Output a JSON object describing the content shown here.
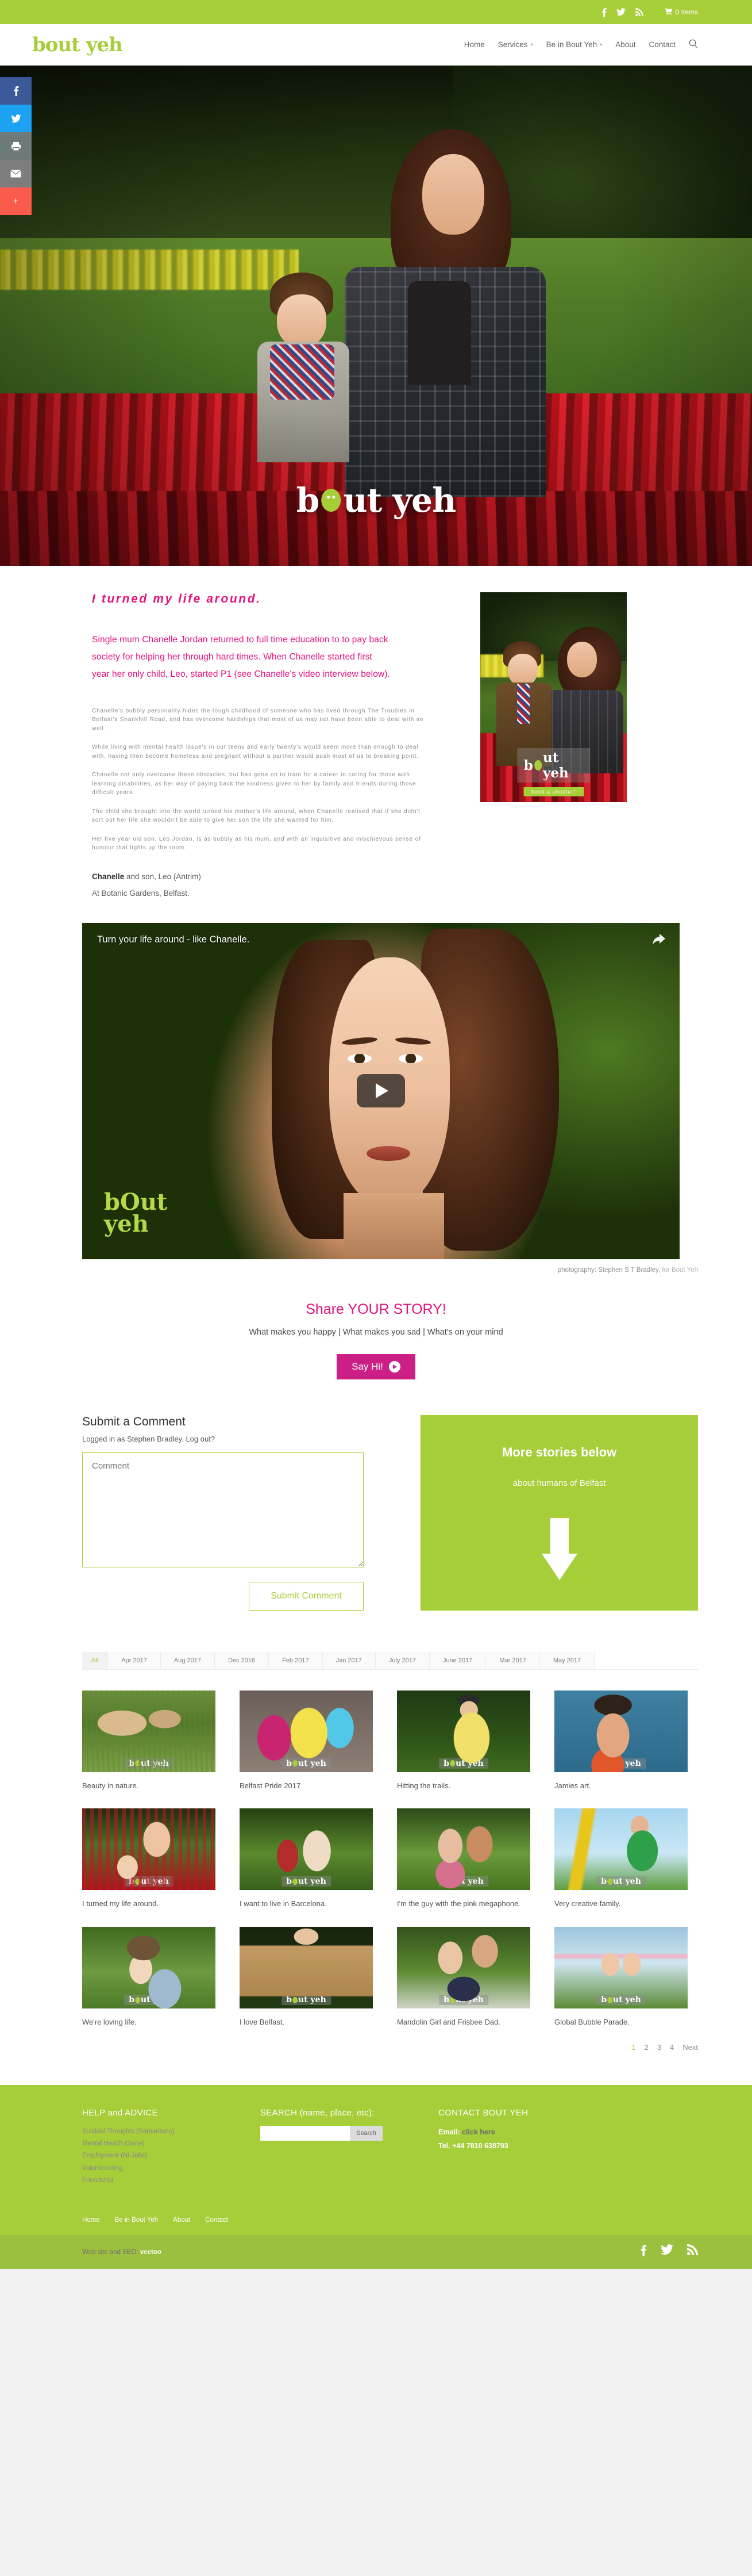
{
  "topbar": {
    "social": [
      {
        "name": "facebook-icon",
        "glyph": "f"
      },
      {
        "name": "twitter-icon",
        "glyph": "🐦"
      },
      {
        "name": "rss-icon",
        "glyph": "≋"
      }
    ],
    "cart_label": "0 Items",
    "cart_icon": "cart-icon"
  },
  "header": {
    "logo": "bout yeh",
    "nav": [
      {
        "label": "Home",
        "has_caret": false
      },
      {
        "label": "Services",
        "has_caret": true
      },
      {
        "label": "Be in Bout Yeh",
        "has_caret": true
      },
      {
        "label": "About",
        "has_caret": false
      },
      {
        "label": "Contact",
        "has_caret": false
      }
    ],
    "search_icon": "search-icon"
  },
  "share_rail": [
    {
      "name": "share-facebook",
      "glyph": "f"
    },
    {
      "name": "share-twitter",
      "glyph": "🐦"
    },
    {
      "name": "share-print",
      "glyph": "⎙"
    },
    {
      "name": "share-email",
      "glyph": "✉"
    },
    {
      "name": "share-more",
      "glyph": "+"
    }
  ],
  "hero": {
    "logo_text_1": "b",
    "logo_text_2": "ut yeh"
  },
  "article": {
    "headline": "I turned my life around.",
    "lead": "Single mum Chanelle Jordan returned to full time education to to pay back society for helping her through hard times. When Chanelle started first year her only child, Leo, started P1 (see Chanelle's video interview below).",
    "paragraphs": [
      "Chanelle's bubbly personality hides the tough childhood of someone who has lived through The Troubles in Belfast's Shankhill Road, and has overcome hardships that most of us may not have been able to deal with so well.",
      "While living with mental health issue's in our teens and early twenty's would seem more than enough to deal with, having then become homeless and pregnant without a partner would push most of us to breaking point.",
      "Chanelle not only overcame these obstacles, but has gone on to train for a career in caring for those with learning disabilities, as her way of paying back the kindness given to her by family and friends during those difficult years.",
      "The child she brought into the world turned his mother's life around, when Chanelle realised that if she didn't sort out her life she wouldn't be able to give her son the life she wanted for him.",
      "Her five year old son, Leo Jordan, is as bubbly as his mum, and with an inquisitive and mischievous sense of humour that lights up the room."
    ],
    "signature_name": "Chanelle",
    "signature_rest": " and son, Leo (Antrim)",
    "location": "At Botanic Gardens, Belfast."
  },
  "side_photo": {
    "watermark_1": "b",
    "watermark_2": "ut yeh",
    "cta": "book a shooter!"
  },
  "video": {
    "title": "Turn your life around - like Chanelle.",
    "share_icon": "share-arrow-icon",
    "play_icon": "play-button-icon",
    "logo_line1": "bOut",
    "logo_line2": "yeh"
  },
  "credit": {
    "prefix": "photography: Stephen S T Bradley,",
    "suffix": "for Bout Yeh"
  },
  "share_story": {
    "title": "Share YOUR STORY!",
    "subtitle": "What makes you happy | What makes you sad | What's on your mind",
    "button": "Say Hi!"
  },
  "comment_form": {
    "title": "Submit a Comment",
    "logged_in": "Logged in as Stephen Bradley. Log out?",
    "textarea_placeholder": "Comment",
    "textarea_value": "",
    "submit_label": "Submit Comment"
  },
  "promo": {
    "title": "More stories below",
    "subtitle": "about humans of Belfast",
    "arrow_icon": "down-arrow-icon"
  },
  "filters": [
    {
      "label": "All",
      "active": true
    },
    {
      "label": "Apr 2017",
      "active": false
    },
    {
      "label": "Aug 2017",
      "active": false
    },
    {
      "label": "Dec 2016",
      "active": false
    },
    {
      "label": "Feb 2017",
      "active": false
    },
    {
      "label": "Jan 2017",
      "active": false
    },
    {
      "label": "July 2017",
      "active": false
    },
    {
      "label": "June 2017",
      "active": false
    },
    {
      "label": "Mar 2017",
      "active": false
    },
    {
      "label": "May 2017",
      "active": false
    }
  ],
  "gallery": [
    {
      "caption": "Beauty in nature.",
      "watermark": true
    },
    {
      "caption": "Belfast Pride 2017",
      "watermark": true
    },
    {
      "caption": "Hitting the trails.",
      "watermark": true
    },
    {
      "caption": "Jamies art.",
      "watermark": true
    },
    {
      "caption": "I turned my life around.",
      "watermark": true
    },
    {
      "caption": "I want to live in Barcelona.",
      "watermark": true
    },
    {
      "caption": "I'm the guy with the pink megaphone.",
      "watermark": true
    },
    {
      "caption": "Very creative family.",
      "watermark": true
    },
    {
      "caption": "We're loving life.",
      "watermark": true
    },
    {
      "caption": "I love Belfast.",
      "watermark": true
    },
    {
      "caption": "Mandolin Girl and Frisbee Dad.",
      "watermark": true
    },
    {
      "caption": "Global Bubble Parade.",
      "watermark": true
    }
  ],
  "watermark": {
    "part1": "b",
    "part2": "ut yeh"
  },
  "pagination": {
    "pages": [
      "1",
      "2",
      "3",
      "4"
    ],
    "current": "1",
    "next_label": "Next"
  },
  "footer": {
    "help": {
      "title": "HELP and ADVICE",
      "links": [
        "Suicidal Thoughts (Samaritans)",
        "Mental Health (Sane)",
        "Employment (NI Jobs)",
        "Volunteeering",
        "Friendship"
      ]
    },
    "search": {
      "title": "SEARCH (name, place, etc):",
      "value": "",
      "placeholder": "",
      "button": "Search"
    },
    "contact": {
      "title": "CONTACT BOUT YEH",
      "email_label": "Email:",
      "email_link": "click here",
      "tel": "Tel. +44 7810 638793"
    },
    "nav": [
      "Home",
      "Be in Bout Yeh",
      "About",
      "Contact"
    ],
    "bottom_credit_prefix": "Web site and SEO:",
    "bottom_credit_name": "veetoo",
    "bottom_social": [
      {
        "name": "facebook-icon",
        "glyph": "f"
      },
      {
        "name": "twitter-icon",
        "glyph": "🐦"
      },
      {
        "name": "rss-icon",
        "glyph": "≋"
      }
    ]
  },
  "colors": {
    "brand_green": "#a6ce39",
    "brand_pink": "#e5127d",
    "button_pink": "#cc1f86",
    "footer_bottom": "#9bbf3e"
  }
}
